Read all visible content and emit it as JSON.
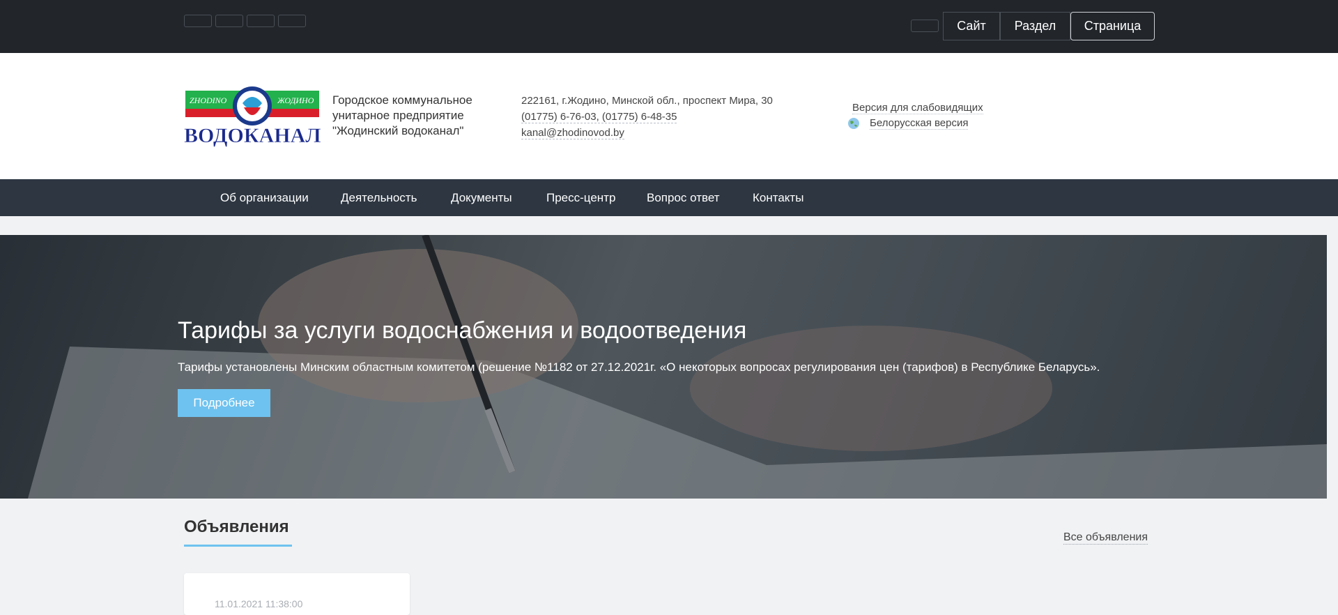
{
  "adminbar": {
    "buttons": [
      "Сайт",
      "Раздел",
      "Страница"
    ]
  },
  "header": {
    "org_lines": [
      "Городское коммунальное",
      "унитарное предприятие",
      "\"Жодинский водоканал\""
    ],
    "address": "222161, г.Жодино, Минской обл., проспект Мира, 30",
    "phones": "(01775) 6-76-03,   (01775) 6-48-35",
    "email": "kanal@zhodinovod.by",
    "accessibility": "Версия для слабовидящих",
    "belarusian": "Белорусская версия",
    "logo": {
      "left_text": "ZHODINO",
      "right_text": "ЖОДИНО",
      "main_text": "ВОДОКАНАЛ"
    }
  },
  "nav": {
    "items": [
      "Об организации",
      "Деятельность",
      "Документы",
      "Пресс-центр",
      "Вопрос ответ",
      "Контакты"
    ]
  },
  "hero": {
    "title": "Тарифы за услуги водоснабжения и водоотведения",
    "text": "Тарифы установлены Минским областным комитетом (решение №1182 от 27.12.2021г. «О некоторых вопросах регулирования цен (тарифов) в Республике Беларусь».",
    "button": "Подробнее"
  },
  "announcements": {
    "title": "Объявления",
    "all_link": "Все объявления",
    "items": [
      {
        "date": "11.01.2021 11:38:00"
      }
    ]
  },
  "colors": {
    "admin_bg": "#22262b",
    "nav_bg": "#2d3641",
    "accent": "#6ec2ef",
    "page_bg": "#f1f2f4"
  }
}
